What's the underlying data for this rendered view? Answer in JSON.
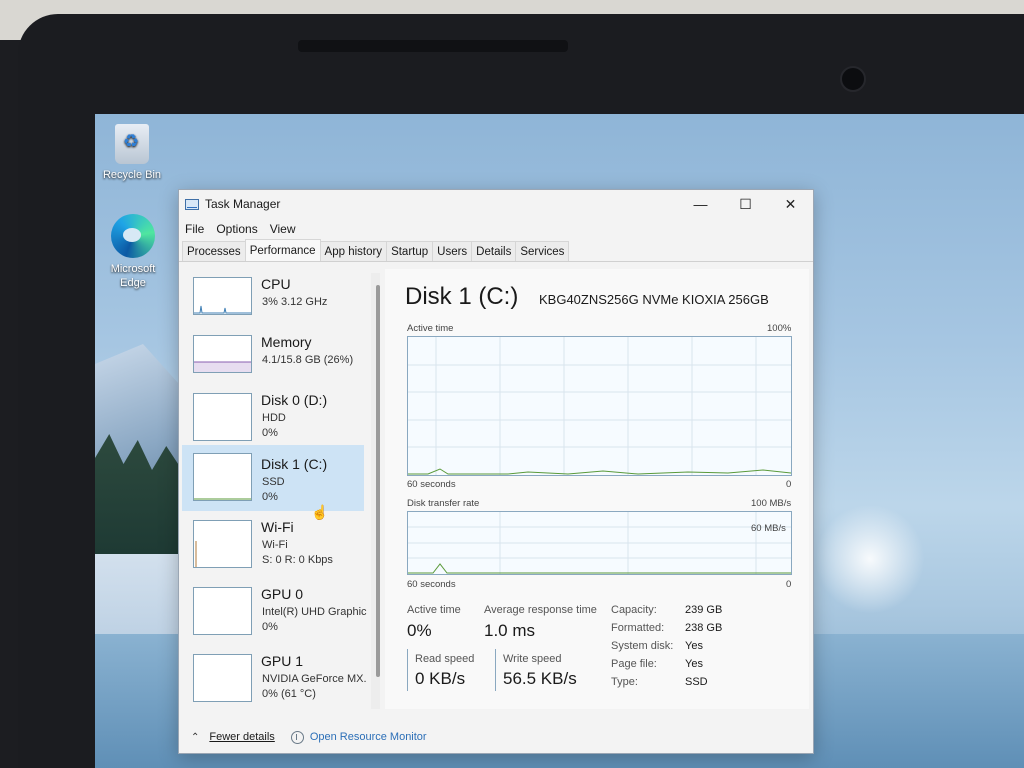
{
  "desktop": {
    "icons": [
      {
        "label": "Recycle Bin",
        "icon": "recycle-bin-icon"
      },
      {
        "label": "Microsoft Edge",
        "icon": "edge-icon"
      }
    ]
  },
  "window": {
    "title": "Task Manager",
    "controls": {
      "minimize": "—",
      "maximize": "☐",
      "close": "✕"
    }
  },
  "menu": [
    "File",
    "Options",
    "View"
  ],
  "tabs": [
    "Processes",
    "Performance",
    "App history",
    "Startup",
    "Users",
    "Details",
    "Services"
  ],
  "active_tab": "Performance",
  "sidebar": {
    "items": [
      {
        "title": "CPU",
        "lines": [
          "3% 3.12 GHz"
        ]
      },
      {
        "title": "Memory",
        "lines": [
          "4.1/15.8 GB (26%)"
        ]
      },
      {
        "title": "Disk 0 (D:)",
        "lines": [
          "HDD",
          "0%"
        ]
      },
      {
        "title": "Disk 1 (C:)",
        "lines": [
          "SSD",
          "0%"
        ],
        "selected": true
      },
      {
        "title": "Wi-Fi",
        "lines": [
          "Wi-Fi",
          "S: 0 R: 0 Kbps"
        ]
      },
      {
        "title": "GPU 0",
        "lines": [
          "Intel(R) UHD Graphic",
          "0%"
        ]
      },
      {
        "title": "GPU 1",
        "lines": [
          "NVIDIA GeForce MX.",
          "0% (61 °C)"
        ]
      }
    ]
  },
  "detail": {
    "heading": "Disk 1 (C:)",
    "model": "KBG40ZNS256G NVMe KIOXIA 256GB",
    "active_time_graph": {
      "label": "Active time",
      "max": "100%",
      "time_label": "60 seconds",
      "min": "0"
    },
    "transfer_graph": {
      "label": "Disk transfer rate",
      "max": "100 MB/s",
      "mid": "60 MB/s",
      "time_label": "60 seconds",
      "min": "0"
    },
    "stats": {
      "active_time_label": "Active time",
      "active_time_value": "0%",
      "avg_response_label": "Average response time",
      "avg_response_value": "1.0 ms",
      "read_label": "Read speed",
      "read_value": "0 KB/s",
      "write_label": "Write speed",
      "write_value": "56.5 KB/s"
    },
    "properties": [
      {
        "label": "Capacity:",
        "value": "239 GB"
      },
      {
        "label": "Formatted:",
        "value": "238 GB"
      },
      {
        "label": "System disk:",
        "value": "Yes"
      },
      {
        "label": "Page file:",
        "value": "Yes"
      },
      {
        "label": "Type:",
        "value": "SSD"
      }
    ]
  },
  "footer": {
    "fewer_details": "Fewer details",
    "resource_monitor": "Open Resource Monitor"
  }
}
